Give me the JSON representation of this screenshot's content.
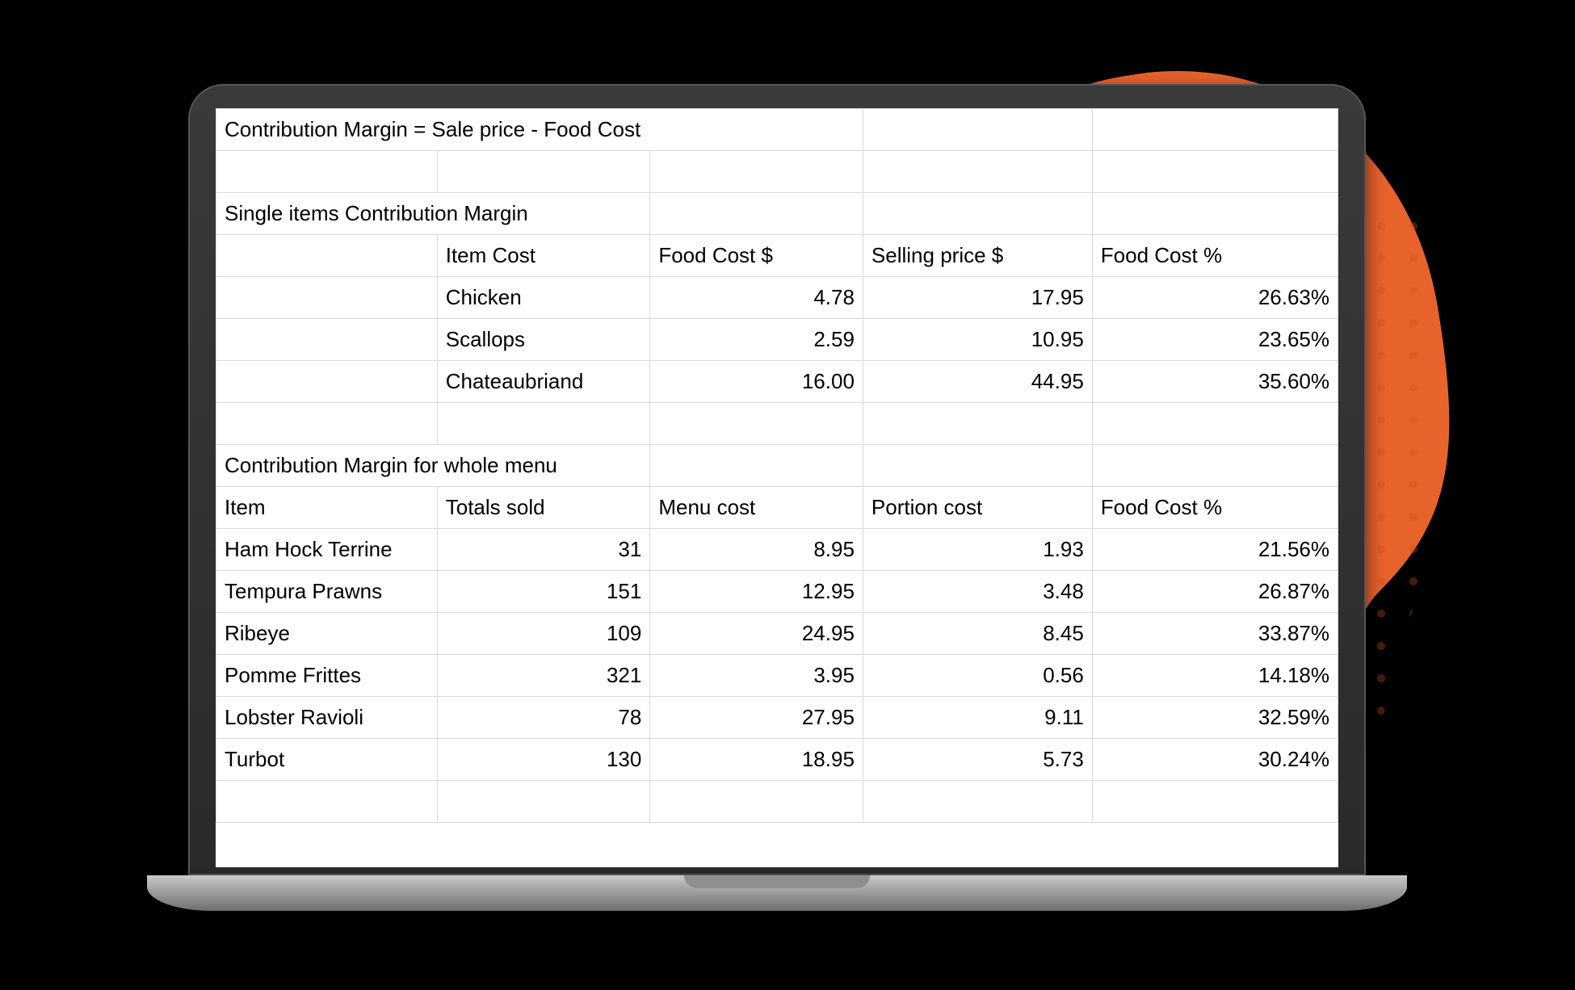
{
  "formula_row": "Contribution Margin = Sale price - Food Cost",
  "section1": {
    "title": "Single items Contribution Margin",
    "headers": [
      "Item Cost",
      "Food Cost $",
      "Selling price $",
      "Food Cost %"
    ],
    "rows": [
      {
        "item": "Chicken",
        "food_cost": "4.78",
        "selling_price": "17.95",
        "food_cost_pct": "26.63%"
      },
      {
        "item": "Scallops",
        "food_cost": "2.59",
        "selling_price": "10.95",
        "food_cost_pct": "23.65%"
      },
      {
        "item": "Chateaubriand",
        "food_cost": "16.00",
        "selling_price": "44.95",
        "food_cost_pct": "35.60%"
      }
    ]
  },
  "section2": {
    "title": "Contribution Margin for whole menu",
    "headers": [
      "Item",
      "Totals sold",
      "Menu cost",
      "Portion cost",
      "Food Cost %"
    ],
    "rows": [
      {
        "item": "Ham Hock Terrine",
        "totals_sold": "31",
        "menu_cost": "8.95",
        "portion_cost": "1.93",
        "food_cost_pct": "21.56%"
      },
      {
        "item": "Tempura Prawns",
        "totals_sold": "151",
        "menu_cost": "12.95",
        "portion_cost": "3.48",
        "food_cost_pct": "26.87%"
      },
      {
        "item": "Ribeye",
        "totals_sold": "109",
        "menu_cost": "24.95",
        "portion_cost": "8.45",
        "food_cost_pct": "33.87%"
      },
      {
        "item": "Pomme Frittes",
        "totals_sold": "321",
        "menu_cost": "3.95",
        "portion_cost": "0.56",
        "food_cost_pct": "14.18%"
      },
      {
        "item": "Lobster Ravioli",
        "totals_sold": "78",
        "menu_cost": "27.95",
        "portion_cost": "9.11",
        "food_cost_pct": "32.59%"
      },
      {
        "item": "Turbot",
        "totals_sold": "130",
        "menu_cost": "18.95",
        "portion_cost": "5.73",
        "food_cost_pct": "30.24%"
      }
    ]
  }
}
